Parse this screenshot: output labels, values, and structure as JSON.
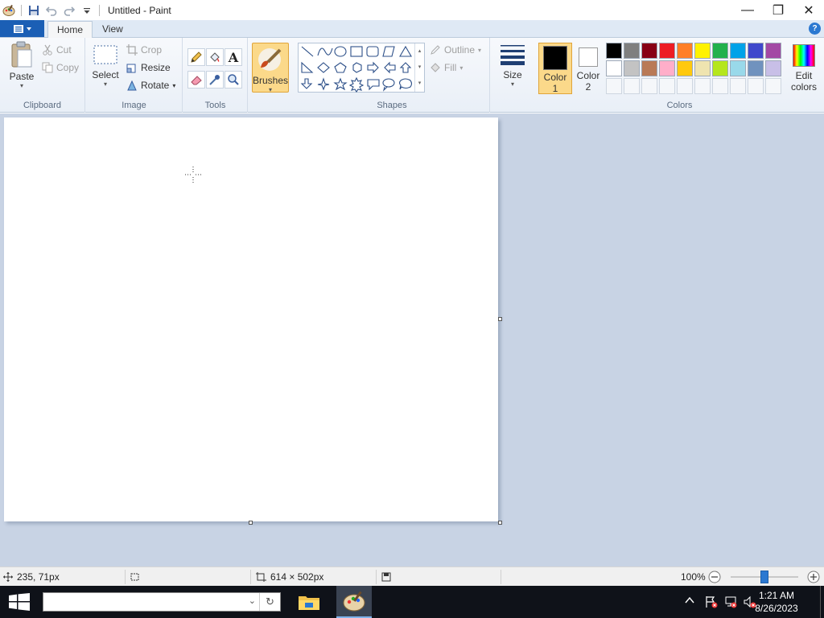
{
  "window": {
    "title": "Untitled - Paint",
    "minimize": "—",
    "maximize": "❐",
    "close": "✕"
  },
  "tabs": [
    "Home",
    "View"
  ],
  "help_label": "?",
  "ribbon": {
    "clipboard": {
      "paste": "Paste",
      "cut": "Cut",
      "copy": "Copy",
      "group": "Clipboard"
    },
    "image": {
      "select": "Select",
      "crop": "Crop",
      "resize": "Resize",
      "rotate": "Rotate",
      "group": "Image"
    },
    "tools": {
      "group": "Tools",
      "text_tool": "A"
    },
    "brushes": {
      "label": "Brushes"
    },
    "shapes": {
      "outline": "Outline",
      "fill": "Fill",
      "group": "Shapes"
    },
    "size": {
      "label": "Size"
    },
    "color1": {
      "line1": "Color",
      "line2": "1"
    },
    "color2": {
      "line1": "Color",
      "line2": "2"
    },
    "colors": {
      "group": "Colors",
      "edit_line1": "Edit",
      "edit_line2": "colors"
    }
  },
  "palette_row1": [
    "#000000",
    "#7f7f7f",
    "#880015",
    "#ed1c24",
    "#ff7f27",
    "#fff200",
    "#22b14c",
    "#00a2e8",
    "#3f48cc",
    "#a349a4"
  ],
  "palette_row2": [
    "#ffffff",
    "#c3c3c3",
    "#b97a57",
    "#ffaec9",
    "#ffc90e",
    "#efe4b0",
    "#b5e61d",
    "#99d9ea",
    "#7092be",
    "#c8bfe7"
  ],
  "color1_value": "#000000",
  "color2_value": "#ffffff",
  "status": {
    "cursor_pos": "235, 71px",
    "canvas_size": "614 × 502px",
    "zoom": "100%",
    "zoom_level": 0.5
  },
  "taskbar": {
    "time": "1:21 AM",
    "date": "8/26/2023"
  }
}
